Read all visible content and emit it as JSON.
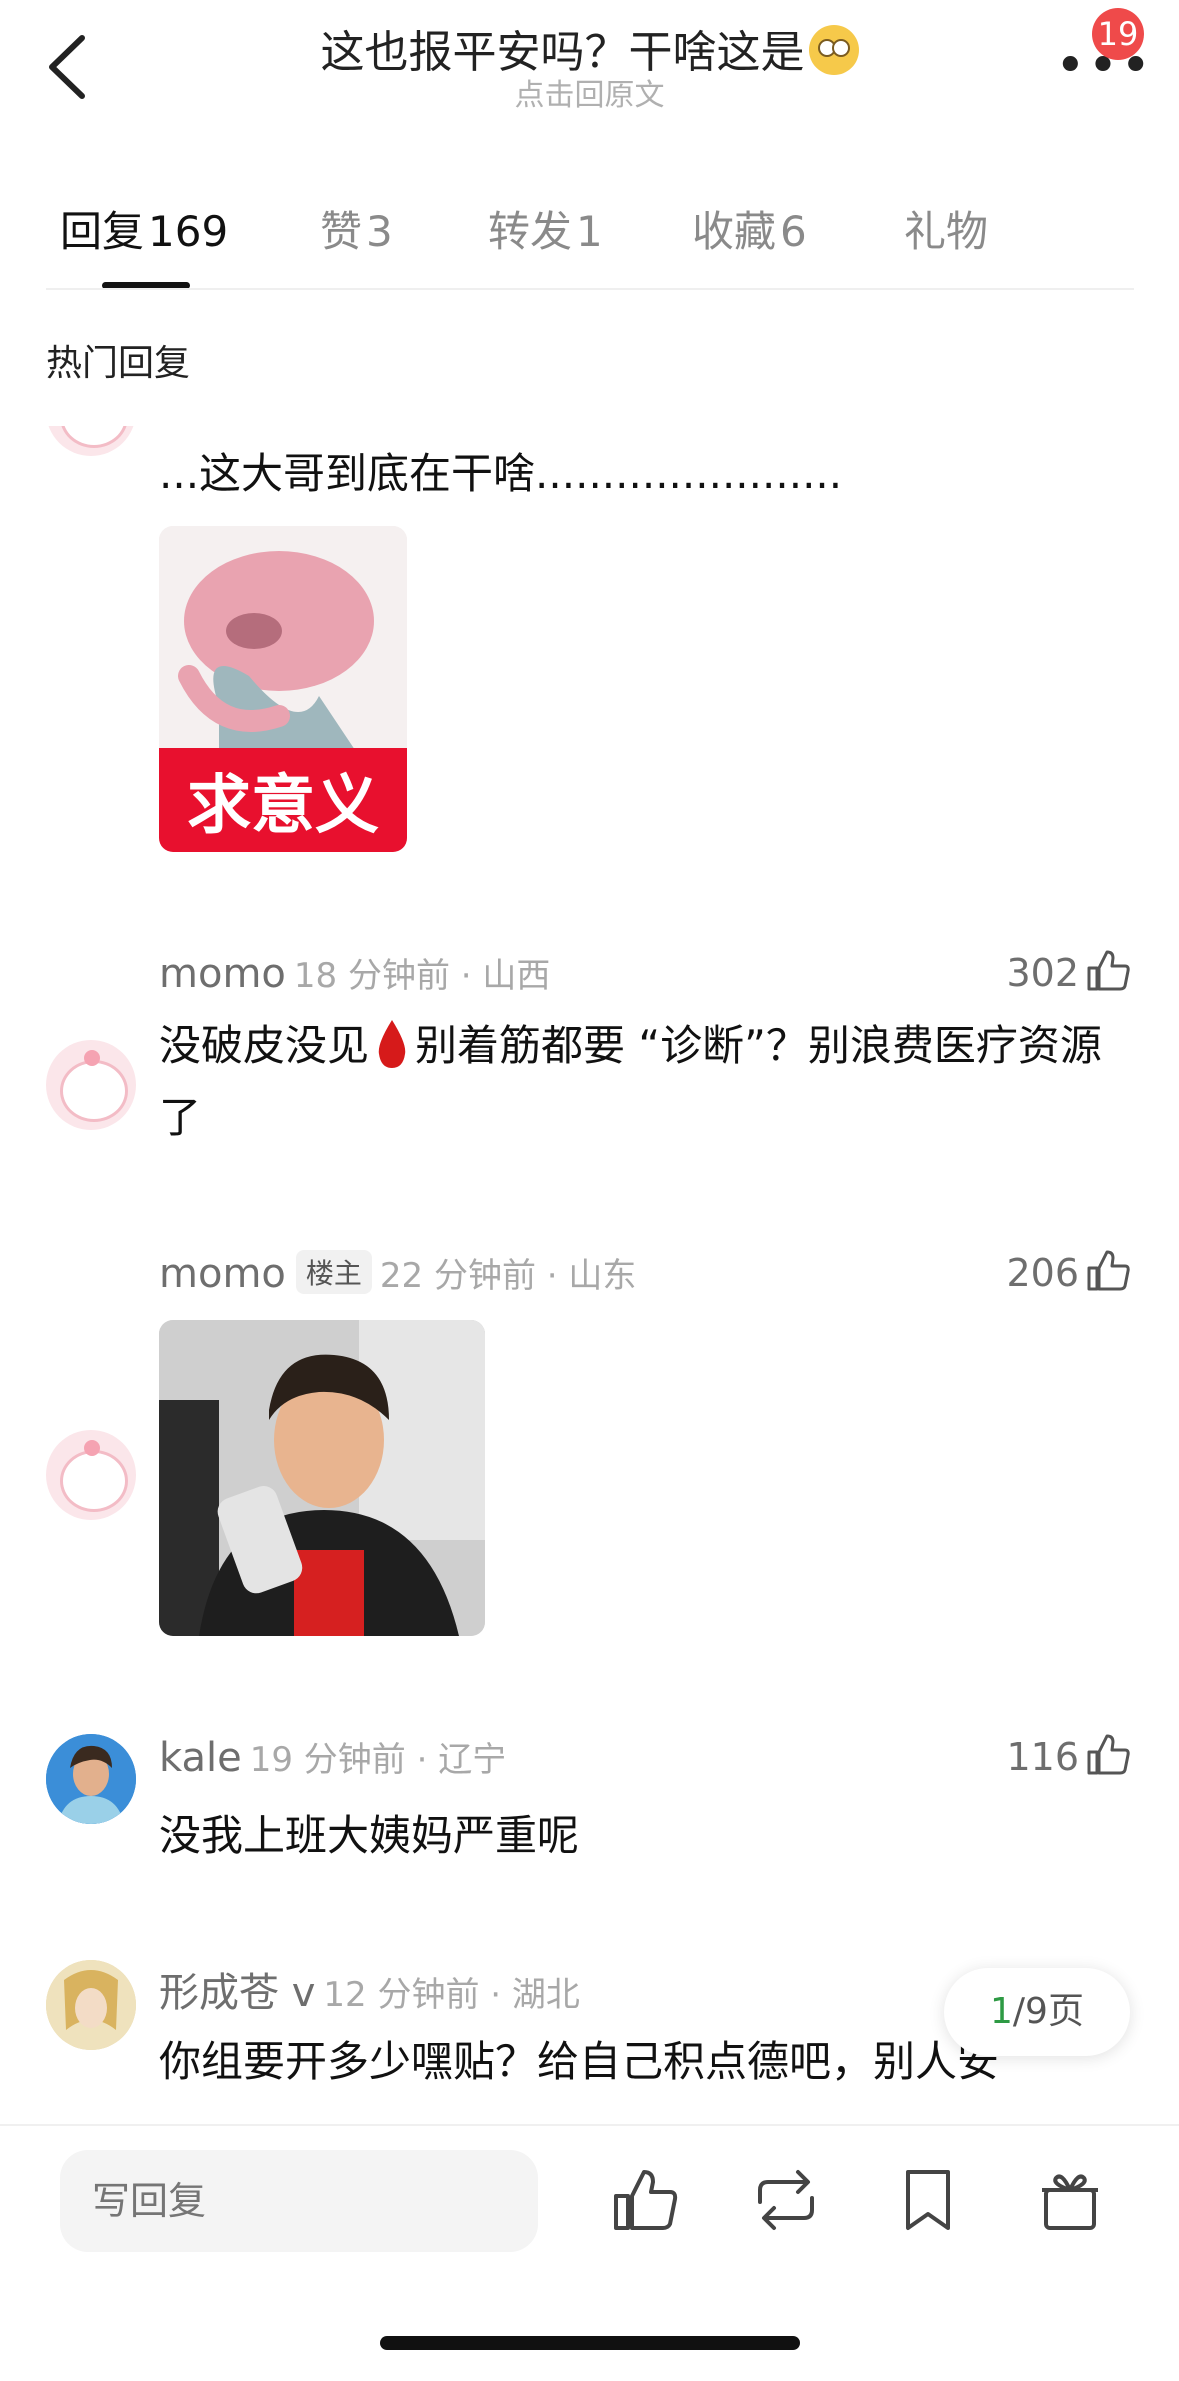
{
  "header": {
    "title": "这也报平安吗？干啥这是",
    "title_emoji": "eye-roll-emoji",
    "subtitle": "点击回原文",
    "badge_count": "19"
  },
  "tabs": [
    {
      "label": "回复",
      "count": "169",
      "active": true
    },
    {
      "label": "赞",
      "count": "3"
    },
    {
      "label": "转发",
      "count": "1"
    },
    {
      "label": "收藏",
      "count": "6"
    },
    {
      "label": "礼物",
      "count": ""
    }
  ],
  "section_title": "热门回复",
  "comments": [
    {
      "text": "...这大哥到底在干啥.......................",
      "image_caption": "求意义"
    },
    {
      "name": "momo",
      "time": "18 分钟前 · 山西",
      "likes": "302",
      "text_before": "没破皮没见",
      "text_after": "别着筋都要 “诊断”？别浪费医疗资源了"
    },
    {
      "name": "momo",
      "tag": "楼主",
      "time": "22 分钟前 · 山东",
      "likes": "206"
    },
    {
      "name": "kale",
      "time": "19 分钟前 · 辽宁",
      "likes": "116",
      "text": "没我上班大姨妈严重呢"
    },
    {
      "name": "形成苍 v",
      "time": "12 分钟前 · 湖北",
      "text": "你组要开多少嘿贴？给自己积点德吧，别人安"
    }
  ],
  "pager": {
    "current": "1",
    "total": "/9页"
  },
  "bottom": {
    "placeholder": "写回复"
  },
  "colors": {
    "accent_green": "#2e9a44",
    "badge_red": "#ef4a4a"
  }
}
